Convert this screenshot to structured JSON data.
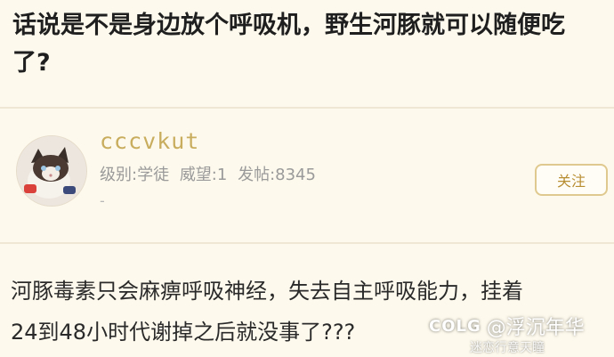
{
  "question": {
    "title": "话说是不是身边放个呼吸机，野生河豚就可以随便吃了?"
  },
  "author": {
    "username": "cccvkut",
    "level": "级别:学徒",
    "prestige": "威望:1",
    "posts": "发帖:8345",
    "extra": "-"
  },
  "follow_button": {
    "label": "关注"
  },
  "reply": {
    "line1": "河豚毒素只会麻痹呼吸神经，失去自主呼吸能力，挂着",
    "line2": "24到48小时代谢掉之后就没事了???"
  },
  "watermark": {
    "logo": "COLG",
    "text": "@浮沉年华",
    "sub": "迷恋行意天瞳"
  },
  "colors": {
    "background": "#fdf9ec",
    "username": "#c9ad5e",
    "button_border": "#e0c98e"
  }
}
